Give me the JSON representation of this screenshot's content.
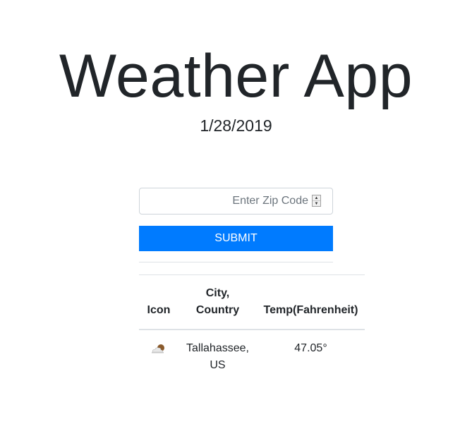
{
  "header": {
    "title": "Weather App",
    "date": "1/28/2019"
  },
  "form": {
    "zip_placeholder": "Enter Zip Code",
    "zip_value": "",
    "submit_label": "SUBMIT"
  },
  "table": {
    "headers": {
      "icon": "Icon",
      "city_country": "City, Country",
      "temp": "Temp(Fahrenheit)"
    },
    "rows": [
      {
        "icon": "partly-cloudy-icon",
        "city_country": "Tallahassee, US",
        "temp": "47.05°"
      }
    ]
  },
  "colors": {
    "accent": "#007bff",
    "text": "#212529",
    "border": "#dee2e6"
  }
}
